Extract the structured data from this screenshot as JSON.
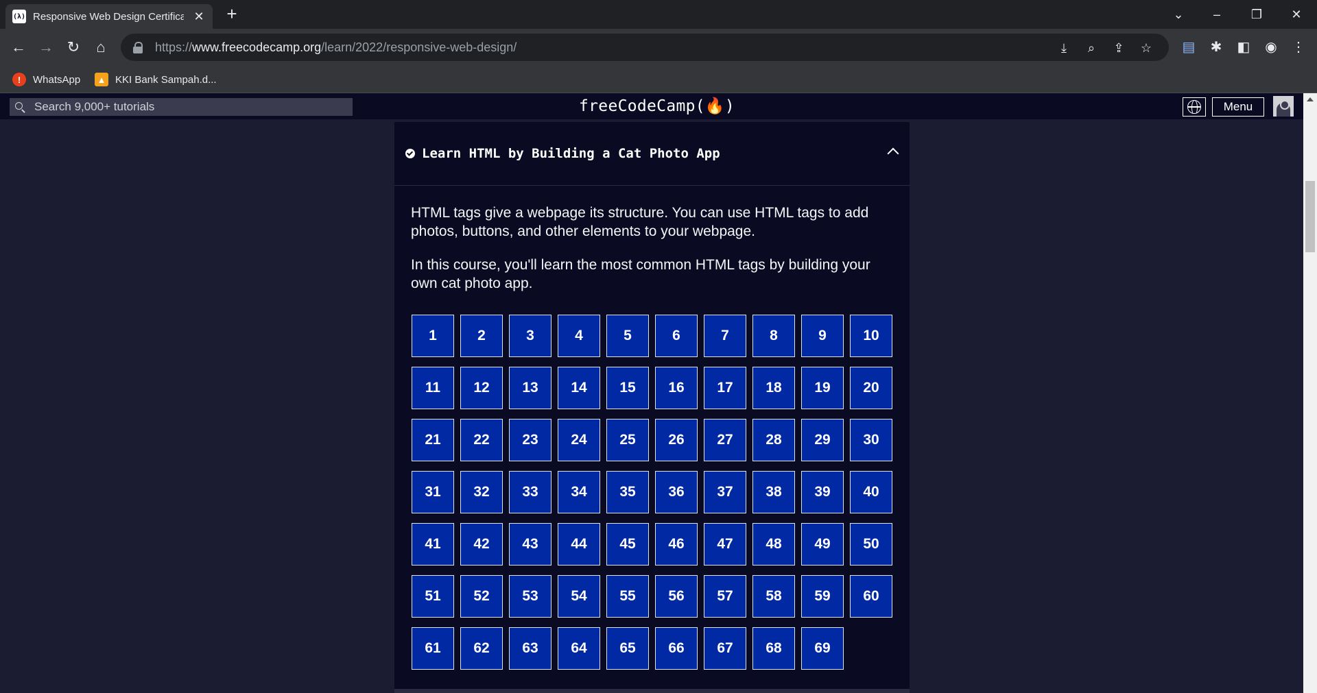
{
  "browser": {
    "tab_title": "Responsive Web Design Certificat",
    "tab_favicon_text": "(λ)",
    "new_tab_symbol": "+",
    "url_prefix": "https://",
    "url_domain": "www.freecodecamp.org",
    "url_path": "/learn/2022/responsive-web-design/",
    "bookmarks": [
      {
        "label": "WhatsApp",
        "icon": "whatsapp-icon",
        "color": "#e8401c"
      },
      {
        "label": "KKI Bank Sampah.d...",
        "icon": "bank-sampah-icon",
        "color": "#f4a21d"
      }
    ]
  },
  "site": {
    "search_placeholder": "Search 9,000+ tutorials",
    "logo_text": "freeCodeCamp(🔥)",
    "menu_label": "Menu"
  },
  "block": {
    "title": "Learn HTML by Building a Cat Photo App",
    "description_1": "HTML tags give a webpage its structure. You can use HTML tags to add photos, buttons, and other elements to your webpage.",
    "description_2": "In this course, you'll learn the most common HTML tags by building your own cat photo app.",
    "steps": [
      "1",
      "2",
      "3",
      "4",
      "5",
      "6",
      "7",
      "8",
      "9",
      "10",
      "11",
      "12",
      "13",
      "14",
      "15",
      "16",
      "17",
      "18",
      "19",
      "20",
      "21",
      "22",
      "23",
      "24",
      "25",
      "26",
      "27",
      "28",
      "29",
      "30",
      "31",
      "32",
      "33",
      "34",
      "35",
      "36",
      "37",
      "38",
      "39",
      "40",
      "41",
      "42",
      "43",
      "44",
      "45",
      "46",
      "47",
      "48",
      "49",
      "50",
      "51",
      "52",
      "53",
      "54",
      "55",
      "56",
      "57",
      "58",
      "59",
      "60",
      "61",
      "62",
      "63",
      "64",
      "65",
      "66",
      "67",
      "68",
      "69"
    ]
  },
  "colors": {
    "page_bg": "#1b1b32",
    "nav_bg": "#0a0a23",
    "step_bg": "#0029a3",
    "step_border": "#dbe4ff"
  }
}
